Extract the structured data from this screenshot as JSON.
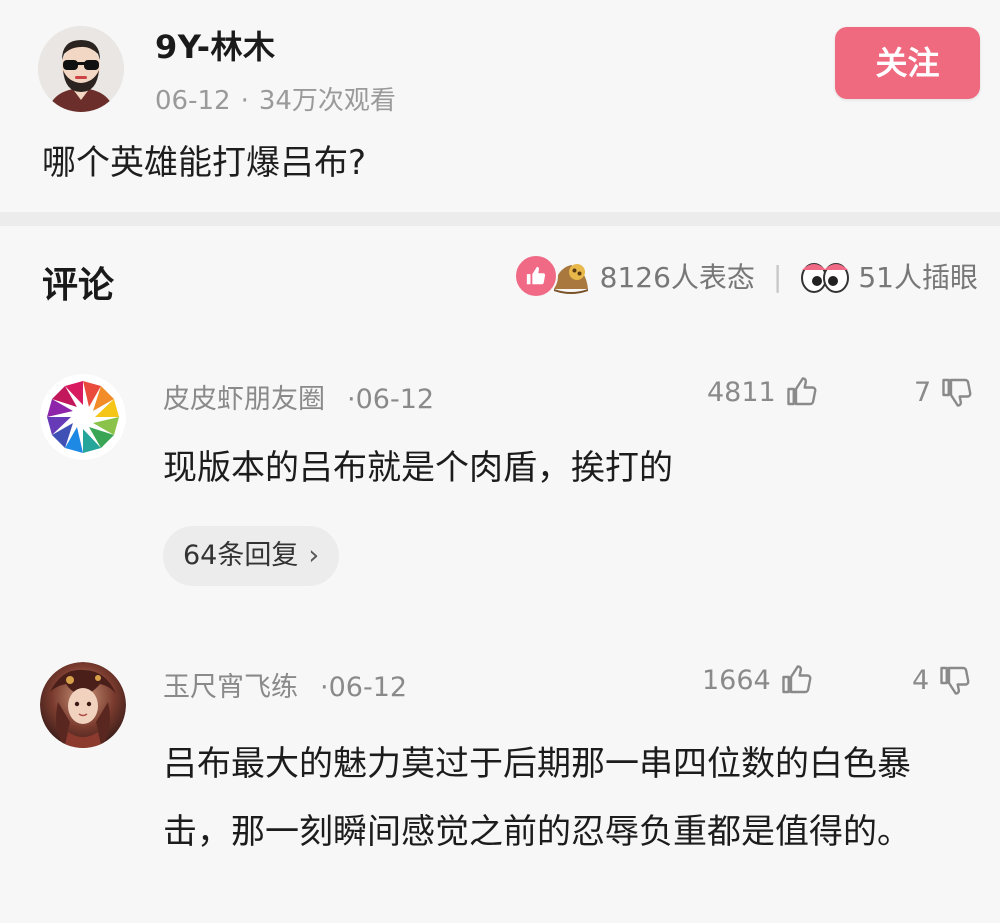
{
  "post": {
    "author": "9Y-林木",
    "date": "06-12",
    "views": "34万次观看",
    "follow_label": "关注",
    "title": "哪个英雄能打爆吕布?"
  },
  "comments_header": {
    "title": "评论",
    "reactions_text": "8126人表态",
    "eyes_text": "51人插眼",
    "separator": "|"
  },
  "comments": [
    {
      "author": "皮皮虾朋友圈",
      "date": "06-12",
      "likes": "4811",
      "dislikes": "7",
      "text": "现版本的吕布就是个肉盾，挨打的",
      "replies": "64条回复"
    },
    {
      "author": "玉尺宵飞练",
      "date": "06-12",
      "likes": "1664",
      "dislikes": "4",
      "text": "吕布最大的魅力莫过于后期那一串四位数的白色暴击，那一刻瞬间感觉之前的忍辱负重都是值得的。"
    }
  ],
  "colors": {
    "accent": "#ef6a7f",
    "muted_text": "#8a8a8a",
    "background": "#f7f7f7"
  },
  "icons": {
    "thumb": "thumbs-up-icon",
    "dislike": "thumbs-down-icon",
    "eyes": "eyes-icon",
    "chevron": "chevron-right-icon"
  }
}
